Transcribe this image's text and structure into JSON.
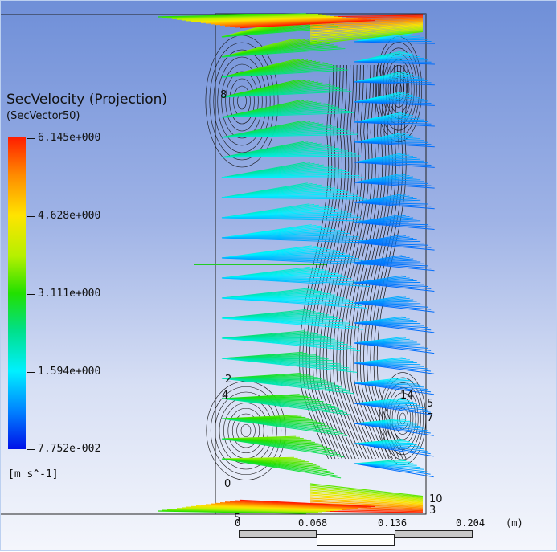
{
  "legend": {
    "title": "SecVelocity (Projection)",
    "subtitle": "(SecVector50)",
    "ticks": [
      "6.145e+000",
      "4.628e+000",
      "3.111e+000",
      "1.594e+000",
      "7.752e-002"
    ],
    "units": "[m s^-1]"
  },
  "contour_labels": [
    "8",
    "2",
    "4",
    "14",
    "5",
    "7",
    "0",
    "10",
    "3",
    "5"
  ],
  "scale_bar": {
    "labels": [
      "0",
      "0.068",
      "0.136",
      "0.204"
    ],
    "unit": "(m)"
  },
  "colors": {
    "background_top": "#6f8fd8",
    "background_bottom": "#f4f6fc",
    "contour_line": "#111111",
    "probe_line": "#22cc22"
  }
}
